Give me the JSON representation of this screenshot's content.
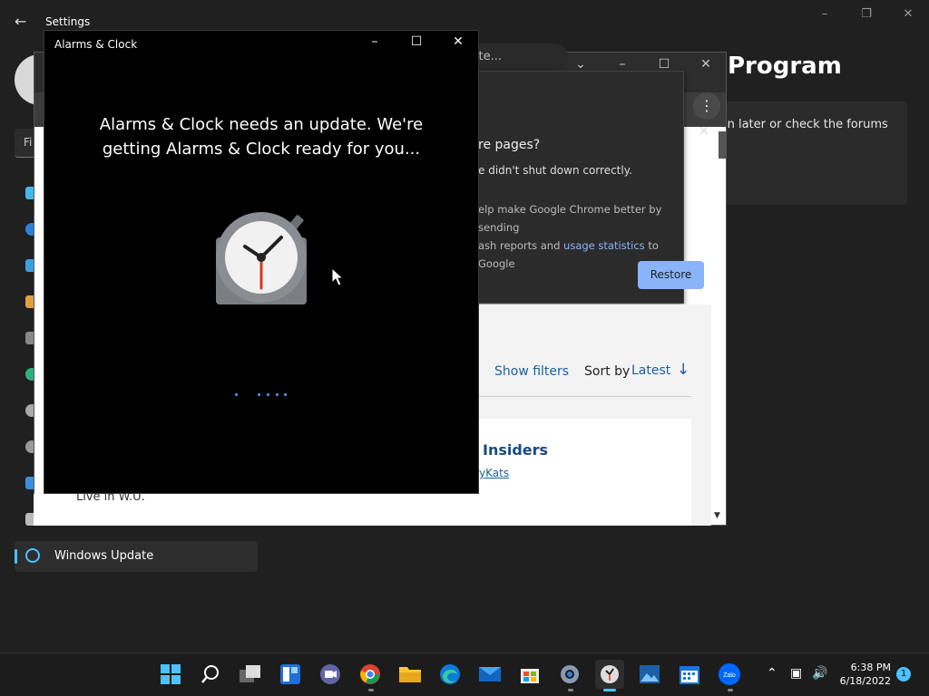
{
  "settings": {
    "title": "Settings",
    "search_partial": "Fi",
    "page_title_partial": "Program",
    "card_text_partial": "in later or check the forums",
    "selected_nav": "Windows Update"
  },
  "chrome": {
    "omnibox_partial": "plyDate...",
    "popup": {
      "title_partial": "re pages?",
      "subtitle_partial": "e didn't shut down correctly.",
      "body_line1": "elp make Google Chrome better by sending",
      "body_line2_pre": "ash reports and ",
      "body_link": "usage statistics",
      "body_line2_post": " to Google",
      "restore_label": "Restore"
    },
    "page": {
      "show_filters": "Show filters",
      "sort_by": "Sort by",
      "sort_value": "Latest",
      "post_title_partial": "Insiders",
      "post_author_partial": "yKats",
      "lower_text": "Live in W.U."
    }
  },
  "alarms": {
    "title": "Alarms & Clock",
    "message_line1": "Alarms & Clock needs an update. We're",
    "message_line2": "getting Alarms & Clock ready for you..."
  },
  "taskbar": {
    "time": "6:38 PM",
    "date": "6/18/2022",
    "notification_count": "1",
    "apps": [
      "start-icon",
      "search-icon",
      "task-view-icon",
      "widgets-icon",
      "teams-chat-icon",
      "chrome-icon",
      "file-explorer-icon",
      "edge-icon",
      "mail-icon",
      "store-icon",
      "settings-icon",
      "alarms-clock-icon",
      "photos-icon",
      "calendar-icon",
      "zalo-icon"
    ]
  },
  "colors": {
    "accent": "#4cc2ff",
    "restore_button": "#8ab4f8",
    "link": "#1a5fa0"
  }
}
